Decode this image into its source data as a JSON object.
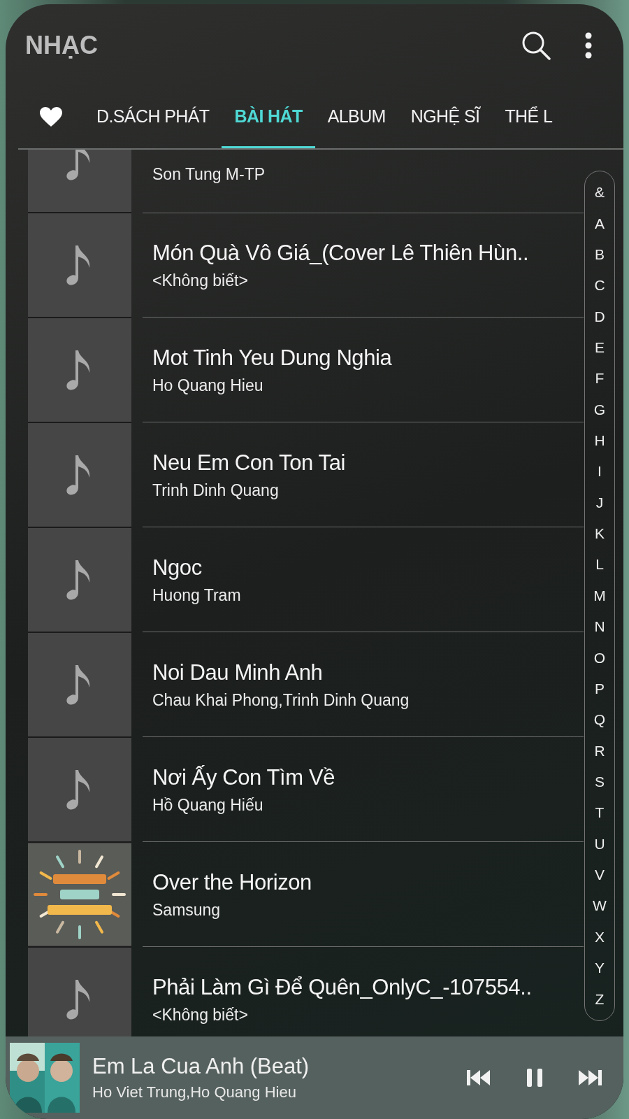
{
  "app_bar": {
    "title": "NHẠC"
  },
  "tabs": [
    {
      "kind": "icon",
      "selected": false
    },
    {
      "kind": "text",
      "label": "D.SÁCH PHÁT",
      "selected": false
    },
    {
      "kind": "text",
      "label": "BÀI HÁT",
      "selected": true
    },
    {
      "kind": "text",
      "label": "ALBUM",
      "selected": false
    },
    {
      "kind": "text",
      "label": "NGHỆ SĨ",
      "selected": false
    },
    {
      "kind": "text",
      "label": "THỂ L",
      "selected": false
    }
  ],
  "songs": [
    {
      "kind": "note",
      "artist": "Son Tung M-TP",
      "partial": true
    },
    {
      "kind": "note",
      "title": "Món Quà Vô Giá_(Cover Lê Thiên Hùn..",
      "artist": "<Không biết>"
    },
    {
      "kind": "note",
      "title": "Mot Tinh Yeu Dung Nghia",
      "artist": "Ho Quang Hieu"
    },
    {
      "kind": "note",
      "title": "Neu Em Con Ton Tai",
      "artist": "Trinh Dinh Quang"
    },
    {
      "kind": "note",
      "title": "Ngoc",
      "artist": "Huong Tram"
    },
    {
      "kind": "note",
      "title": "Noi Dau Minh Anh",
      "artist": "Chau Khai Phong,Trinh Dinh Quang"
    },
    {
      "kind": "note",
      "title": "Nơi Ấy Con Tìm Về",
      "artist": "Hồ Quang Hiếu"
    },
    {
      "kind": "picture",
      "title": "Over the Horizon",
      "artist": "Samsung"
    },
    {
      "kind": "note",
      "title": "Phải Làm Gì Để Quên_OnlyC_-107554..",
      "artist": "<Không biết>"
    }
  ],
  "index_letters": [
    "&",
    "A",
    "B",
    "C",
    "D",
    "E",
    "F",
    "G",
    "H",
    "I",
    "J",
    "K",
    "L",
    "M",
    "N",
    "O",
    "P",
    "Q",
    "R",
    "S",
    "T",
    "U",
    "V",
    "W",
    "X",
    "Y",
    "Z"
  ],
  "player": {
    "title": "Em La Cua Anh (Beat)",
    "artist": "Ho Viet Trung,Ho Quang Hieu",
    "playing": true
  }
}
